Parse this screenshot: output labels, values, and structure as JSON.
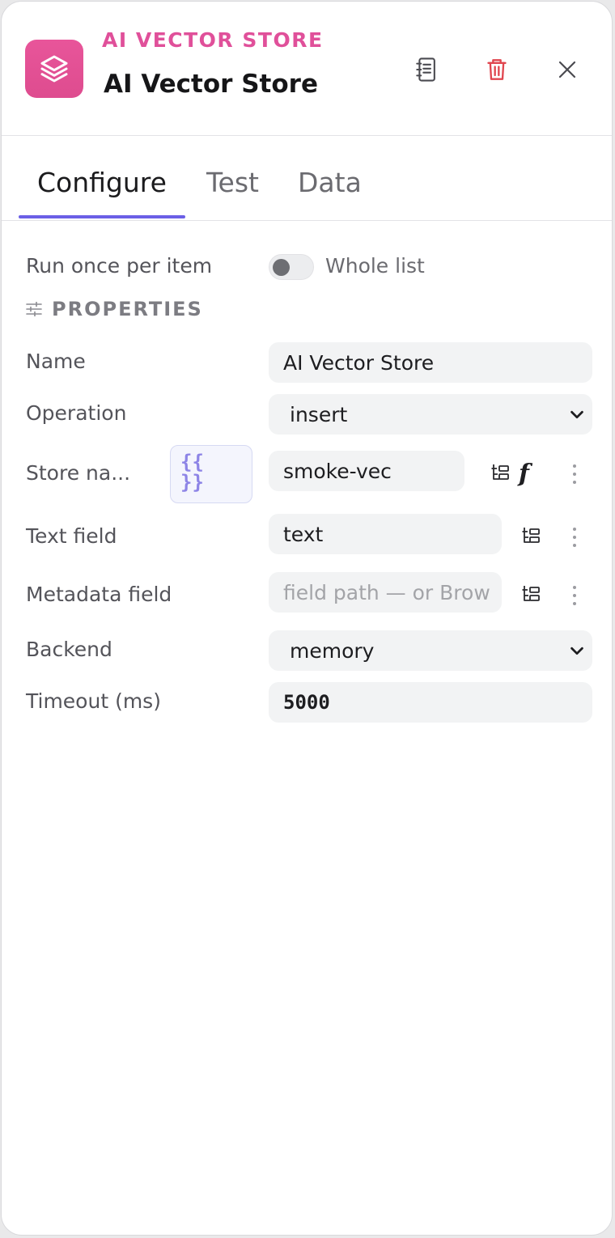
{
  "header": {
    "eyebrow": "AI VECTOR STORE",
    "title": "AI Vector Store",
    "icon": "layers-icon",
    "accent_color": "#e0509a",
    "actions": [
      "docs-icon",
      "trash-icon",
      "close-icon"
    ]
  },
  "tabs": [
    {
      "label": "Configure",
      "active": true
    },
    {
      "label": "Test",
      "active": false
    },
    {
      "label": "Data",
      "active": false
    }
  ],
  "run_mode": {
    "label": "Run once per item",
    "toggle_label": "Whole list",
    "toggle_on": false
  },
  "properties": {
    "heading": "PROPERTIES",
    "name": {
      "label": "Name",
      "value": "AI Vector Store"
    },
    "operation": {
      "label": "Operation",
      "value": "insert"
    },
    "store_name": {
      "label": "Store na...",
      "value": "smoke-vec",
      "expr_glyph_top": "{{",
      "expr_glyph_bottom": "}}",
      "fx_glyph": "f"
    },
    "text_field": {
      "label": "Text field",
      "value": "text"
    },
    "metadata_field": {
      "label": "Metadata field",
      "value": "",
      "placeholder": "field path — or Brow"
    },
    "backend": {
      "label": "Backend",
      "value": "memory"
    },
    "timeout": {
      "label": "Timeout (ms)",
      "value": "5000"
    }
  },
  "colors": {
    "tab_active_underline": "#6b5fe6",
    "delete": "#e0464f",
    "expr": "#8d84e6"
  }
}
